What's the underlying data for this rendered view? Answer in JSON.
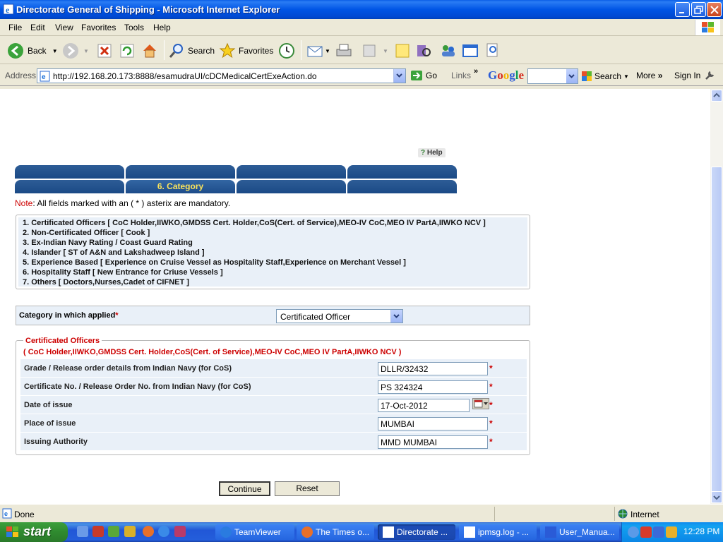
{
  "window": {
    "title": "Directorate General of Shipping - Microsoft Internet Explorer"
  },
  "menu": [
    "File",
    "Edit",
    "View",
    "Favorites",
    "Tools",
    "Help"
  ],
  "toolbar": {
    "back": "Back",
    "search": "Search",
    "favorites": "Favorites"
  },
  "address": {
    "label": "Address",
    "url": "http://192.168.20.173:8888/esamudraUI/cDCMedicalCertExeAction.do",
    "go": "Go",
    "links": "Links"
  },
  "google_bar": {
    "logo": "Google",
    "search": "Search",
    "more": "More",
    "signin": "Sign In"
  },
  "page": {
    "help": "Help",
    "tabs_row1": [
      "",
      "",
      "",
      ""
    ],
    "tabs_row2": [
      "",
      "6. Category",
      "",
      ""
    ],
    "note_label": "Note",
    "note_text": ": All fields marked with an ( * ) asterix are mandatory.",
    "categories": [
      "1.  Certificated Officers  [ CoC Holder,IIWKO,GMDSS Cert. Holder,CoS(Cert. of Service),MEO-IV CoC,MEO IV PartA,IIWKO NCV ]",
      "2.  Non-Certificated Officer  [ Cook ]",
      "3.  Ex-Indian Navy Rating / Coast Guard Rating",
      "4.  Islander  [ ST of A&N and Lakshadweep Island ]",
      "5.  Experience Based [ Experience on Cruise Vessel as Hospitality Staff,Experience on Merchant Vessel ]",
      "6.   Hospitality Staff  [ New Entrance for Criuse Vessels ]",
      "7.  Others  [ Doctors,Nurses,Cadet of CIFNET ]"
    ],
    "category_label": "Category in which applied",
    "category_value": "Certificated Officer",
    "section_title": "Certificated Officers",
    "section_sub": "( CoC Holder,IIWKO,GMDSS Cert. Holder,CoS(Cert. of Service),MEO-IV CoC,MEO IV PartA,IIWKO NCV )",
    "fields": [
      {
        "label": "Grade / Release order details from Indian Navy (for CoS)",
        "value": "DLLR/32432"
      },
      {
        "label": "Certificate No. / Release Order No. from Indian Navy (for CoS)",
        "value": "PS 324324"
      },
      {
        "label": "Date of issue",
        "value": "17-Oct-2012"
      },
      {
        "label": "Place of issue",
        "value": "MUMBAI"
      },
      {
        "label": "Issuing Authority",
        "value": "MMD MUMBAI"
      }
    ],
    "required_mark": "*",
    "continue": "Continue",
    "reset": "Reset"
  },
  "status": {
    "text": "Done",
    "zone": "Internet"
  },
  "taskbar": {
    "start": "start",
    "tasks": [
      "TeamViewer",
      "The Times o...",
      "Directorate ...",
      "ipmsg.log - ...",
      "User_Manua..."
    ],
    "clock": "12:28 PM"
  },
  "colors": {
    "title_blue": "#0055E5",
    "tab_blue": "#1B4A86",
    "tab_text": "#F9E25C",
    "required_red": "#CC0000",
    "row_bg": "#E9F0F8"
  }
}
